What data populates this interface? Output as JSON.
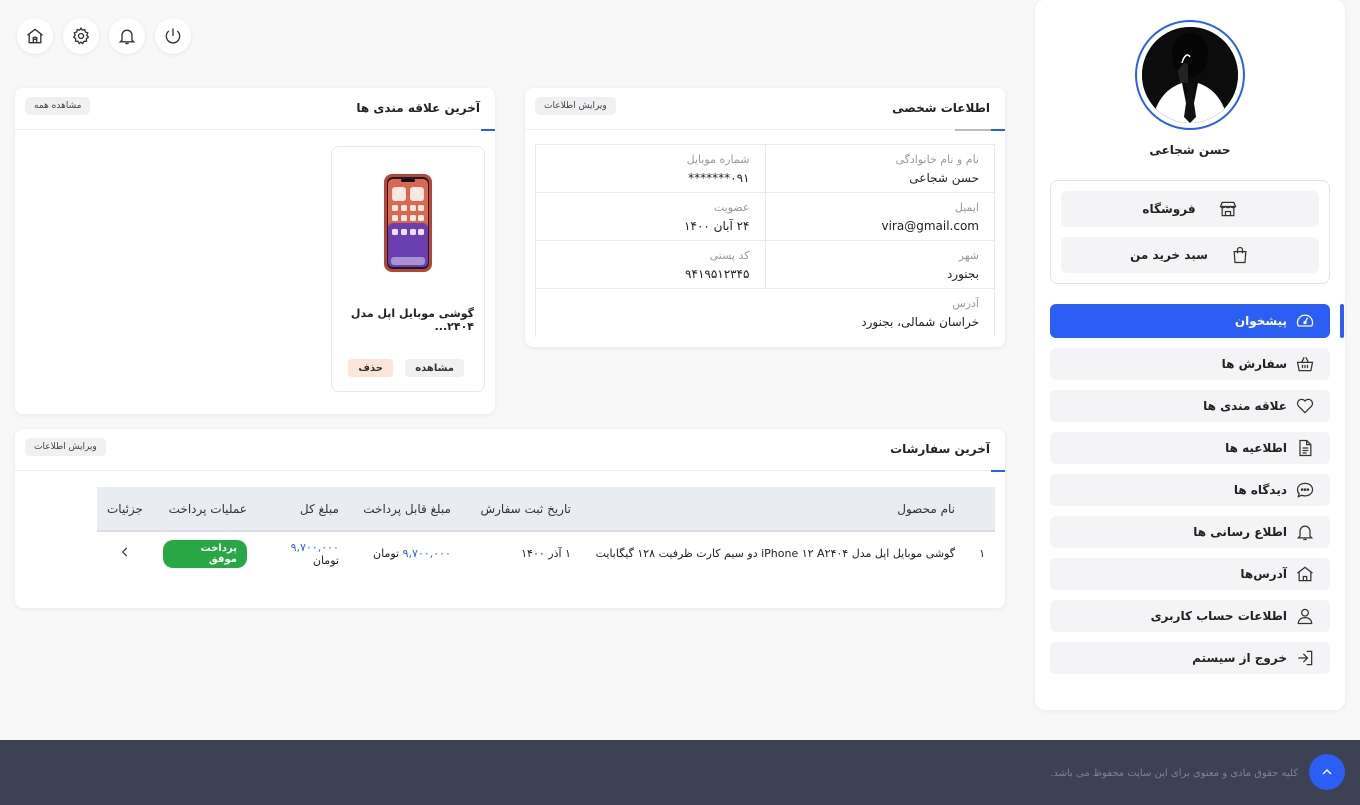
{
  "topbar": {
    "icons": [
      "home-icon",
      "gear-icon",
      "bell-icon",
      "power-icon"
    ]
  },
  "sidebar": {
    "user_name": "حسن شجاعی",
    "shop_links": [
      {
        "label": "فروشگاه",
        "icon": "store-icon"
      },
      {
        "label": "سبد خرید من",
        "icon": "shopping-bag-icon"
      }
    ],
    "menu": [
      {
        "label": "پیشخوان",
        "icon": "dashboard-icon",
        "active": true
      },
      {
        "label": "سفارش ها",
        "icon": "basket-icon"
      },
      {
        "label": "علاقه مندی ها",
        "icon": "heart-icon"
      },
      {
        "label": "اطلاعیه ها",
        "icon": "document-icon"
      },
      {
        "label": "دیدگاه ها",
        "icon": "comment-icon"
      },
      {
        "label": "اطلاع رسانی ها",
        "icon": "bell-icon"
      },
      {
        "label": "آدرس‌ها",
        "icon": "home-icon"
      },
      {
        "label": "اطلاعات حساب کاربری",
        "icon": "user-icon"
      },
      {
        "label": "خروج از سیستم",
        "icon": "logout-icon"
      }
    ],
    "accent_color": "#2a5ef5"
  },
  "personal_info": {
    "title": "اطلاعات شخصی",
    "edit_label": "ویرایش اطلاعات",
    "fields": {
      "full_name_label": "نام و نام خانوادگی",
      "full_name": "حسن شجاعی",
      "mobile_label": "شماره موبایل",
      "mobile": "۰۹۱*******",
      "email_label": "ایمیل",
      "email": "vira@gmail.com",
      "membership_label": "عضویت",
      "membership": "۲۴ آبان ۱۴۰۰",
      "city_label": "شهر",
      "city": "بجنورد",
      "postal_label": "کد پستی",
      "postal": "۹۴۱۹۵۱۲۳۴۵",
      "address_label": "آدرس",
      "address": "خراسان شمالی، بجنورد"
    }
  },
  "favorites": {
    "title": "آخرین علاقه مندی ها",
    "view_all_label": "مشاهده همه",
    "product": {
      "name": "گوشی موبایل اپل مدل ۲۴۰۴...",
      "view_label": "مشاهده",
      "delete_label": "حذف"
    }
  },
  "orders": {
    "title": "آخرین سفارشات",
    "edit_label": "ویرایش اطلاعات",
    "columns": [
      "",
      "نام محصول",
      "تاریخ ثبت سفارش",
      "مبلغ قابل پرداخت",
      "مبلغ کل",
      "عملیات پرداخت",
      "جزئیات"
    ],
    "rows": [
      {
        "index": "۱",
        "product": "گوشی موبایل اپل مدل iPhone ۱۲ A۲۴۰۴ دو سیم کارت ظرفیت ۱۲۸ گیگابایت",
        "date": "۱ آذر ۱۴۰۰",
        "payable_amount": "۹,۷۰۰,۰۰۰",
        "payable_unit": "تومان",
        "total_amount": "۹,۷۰۰,۰۰۰",
        "total_unit": "تومان",
        "payment_status": "پرداخت موفق",
        "payment_status_color": "#28a745"
      }
    ]
  },
  "footer": {
    "copyright": "کلیه حقوق مادی و معنوی برای این سایت محفوظ می باشد."
  }
}
